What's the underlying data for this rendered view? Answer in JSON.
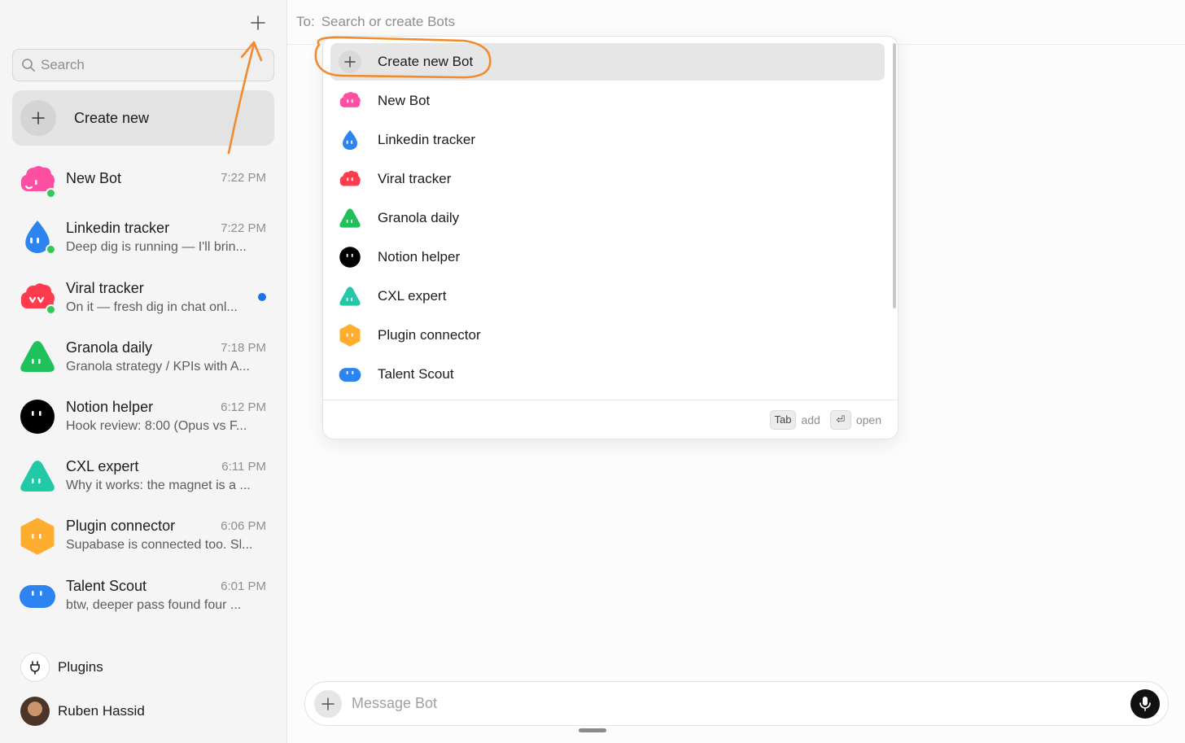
{
  "sidebar": {
    "search_placeholder": "Search",
    "create_new_label": "Create new",
    "conversations": [
      {
        "name": "New Bot",
        "time": "7:22 PM",
        "preview": "",
        "online": true,
        "unread": false,
        "icon": "pink-cloud-icon",
        "color": "#ff4fa3"
      },
      {
        "name": "Linkedin tracker",
        "time": "7:22 PM",
        "preview": "Deep dig is running — I'll brin...",
        "online": true,
        "unread": false,
        "icon": "blue-drop-icon",
        "color": "#2d84f0"
      },
      {
        "name": "Viral tracker",
        "time": "",
        "preview": "On it — fresh dig in chat onl...",
        "online": true,
        "unread": true,
        "icon": "red-cloud-icon",
        "color": "#ff3b4e"
      },
      {
        "name": "Granola daily",
        "time": "7:18 PM",
        "preview": "Granola strategy / KPIs with A...",
        "online": false,
        "unread": false,
        "icon": "green-triangle-icon",
        "color": "#1fc25a"
      },
      {
        "name": "Notion helper",
        "time": "6:12 PM",
        "preview": "Hook review: 8:00 (Opus vs F...",
        "online": false,
        "unread": false,
        "icon": "black-circle-icon",
        "color": "#000000"
      },
      {
        "name": "CXL expert",
        "time": "6:11 PM",
        "preview": "Why it works: the magnet is a ...",
        "online": false,
        "unread": false,
        "icon": "teal-triangle-icon",
        "color": "#22c9a6"
      },
      {
        "name": "Plugin connector",
        "time": "6:06 PM",
        "preview": "Supabase is connected too. Sl...",
        "online": false,
        "unread": false,
        "icon": "orange-hexagon-icon",
        "color": "#ffad2e"
      },
      {
        "name": "Talent Scout",
        "time": "6:01 PM",
        "preview": "btw, deeper pass found four ...",
        "online": false,
        "unread": false,
        "icon": "blue-pill-icon",
        "color": "#2d84f0"
      }
    ],
    "plugins_label": "Plugins",
    "user_name": "Ruben Hassid"
  },
  "main": {
    "to_label": "To:",
    "to_placeholder": "Search or create Bots",
    "dropdown": {
      "create_label": "Create new Bot",
      "items": [
        {
          "label": "New Bot",
          "icon": "pink-cloud-icon",
          "color": "#ff4fa3"
        },
        {
          "label": "Linkedin tracker",
          "icon": "blue-drop-icon",
          "color": "#2d84f0"
        },
        {
          "label": "Viral tracker",
          "icon": "red-cloud-icon",
          "color": "#ff3b4e"
        },
        {
          "label": "Granola daily",
          "icon": "green-triangle-icon",
          "color": "#1fc25a"
        },
        {
          "label": "Notion helper",
          "icon": "black-circle-icon",
          "color": "#000000"
        },
        {
          "label": "CXL expert",
          "icon": "teal-triangle-icon",
          "color": "#22c9a6"
        },
        {
          "label": "Plugin connector",
          "icon": "orange-hexagon-icon",
          "color": "#ffad2e"
        },
        {
          "label": "Talent Scout",
          "icon": "blue-pill-icon",
          "color": "#2d84f0"
        }
      ],
      "footer": {
        "tab_key": "Tab",
        "tab_hint": "add",
        "enter_key": "⏎",
        "enter_hint": "open"
      }
    },
    "composer_placeholder": "Message Bot"
  },
  "annotation": {
    "color": "#f28a2e"
  }
}
